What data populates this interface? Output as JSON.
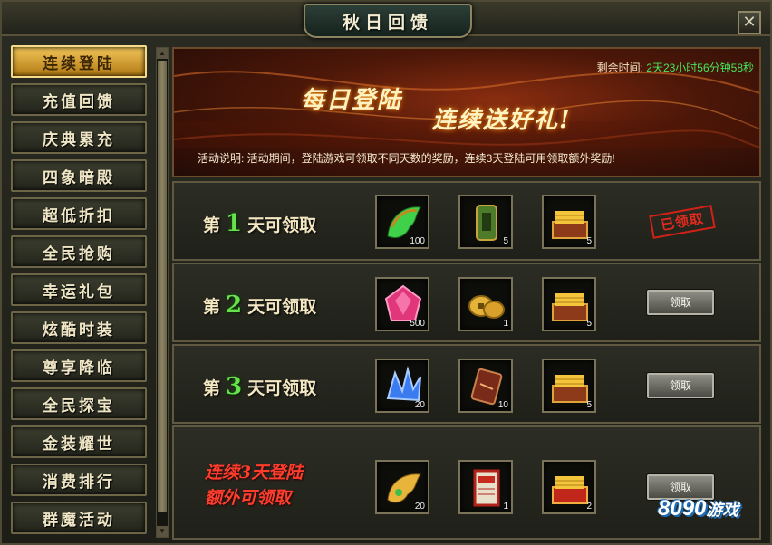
{
  "window": {
    "title": "秋日回馈",
    "close_symbol": "✕"
  },
  "sidebar": {
    "items": [
      {
        "label": "连续登陆",
        "active": true
      },
      {
        "label": "充值回馈"
      },
      {
        "label": "庆典累充"
      },
      {
        "label": "四象暗殿"
      },
      {
        "label": "超低折扣"
      },
      {
        "label": "全民抢购"
      },
      {
        "label": "幸运礼包"
      },
      {
        "label": "炫酷时装"
      },
      {
        "label": "尊享降临"
      },
      {
        "label": "全民探宝"
      },
      {
        "label": "金装耀世"
      },
      {
        "label": "消费排行"
      },
      {
        "label": "群魔活动"
      }
    ]
  },
  "banner": {
    "remaining_label": "剩余时间:",
    "remaining_value": "2天23小时56分钟58秒",
    "slogan_1": "每日登陆",
    "slogan_2": "连续送好礼!",
    "description": "活动说明: 活动期间，登陆游戏可领取不同天数的奖励，连续3天登陆可用领取额外奖励!"
  },
  "rows": [
    {
      "prefix": "第",
      "day": "1",
      "suffix": "天可领取",
      "items": [
        {
          "icon": "green-wing-icon",
          "count": "100"
        },
        {
          "icon": "jade-token-icon",
          "count": "5"
        },
        {
          "icon": "gold-chest-icon",
          "count": "5"
        }
      ],
      "status": "claimed",
      "status_text": "已领取"
    },
    {
      "prefix": "第",
      "day": "2",
      "suffix": "天可领取",
      "items": [
        {
          "icon": "pink-gem-icon",
          "count": "500"
        },
        {
          "icon": "gold-coins-icon",
          "count": "1"
        },
        {
          "icon": "gold-chest-icon",
          "count": "5"
        }
      ],
      "status": "claimable",
      "button_label": "领取"
    },
    {
      "prefix": "第",
      "day": "3",
      "suffix": "天可领取",
      "items": [
        {
          "icon": "blue-crystal-icon",
          "count": "20"
        },
        {
          "icon": "red-scroll-card-icon",
          "count": "10"
        },
        {
          "icon": "gold-chest-icon",
          "count": "5"
        }
      ],
      "status": "claimable",
      "button_label": "领取"
    },
    {
      "extra_line_1": "连续3天登陆",
      "extra_line_2": "额外可领取",
      "items": [
        {
          "icon": "gold-wing-icon",
          "count": "20"
        },
        {
          "icon": "red-scroll-icon",
          "count": "1"
        },
        {
          "icon": "red-gift-chest-icon",
          "count": "2"
        }
      ],
      "status": "claimable",
      "button_label": "领取"
    }
  ],
  "watermark": {
    "digits": "8090",
    "text": "游戏"
  }
}
